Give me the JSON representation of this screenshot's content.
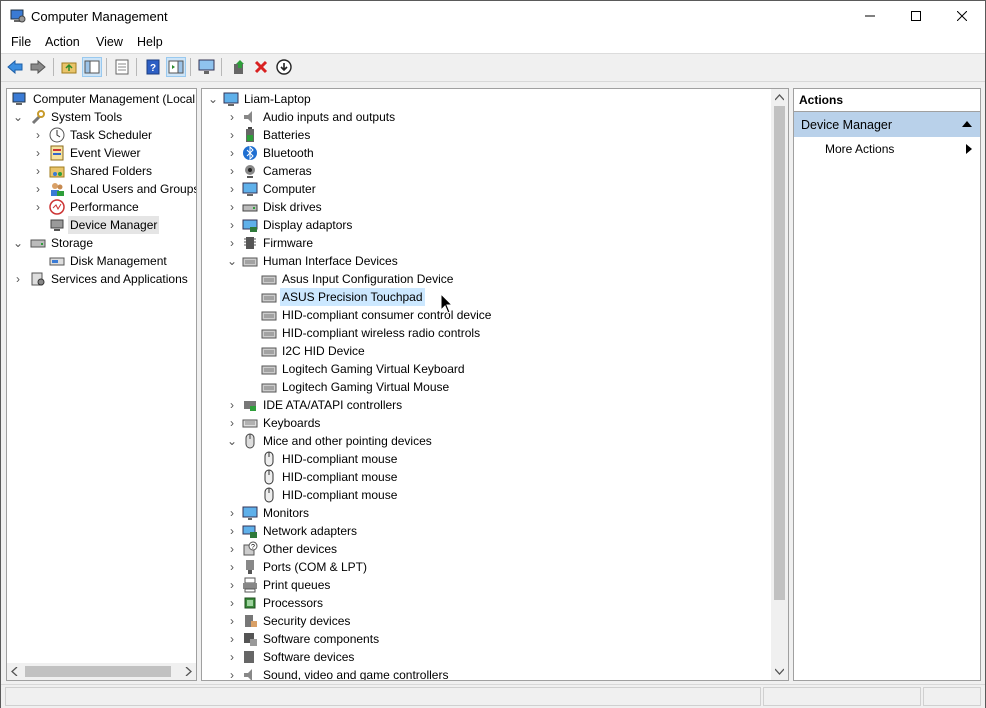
{
  "window": {
    "title": "Computer Management"
  },
  "menu": [
    "File",
    "Action",
    "View",
    "Help"
  ],
  "left_tree": {
    "root": "Computer Management (Local",
    "system_tools": "System Tools",
    "task_scheduler": "Task Scheduler",
    "event_viewer": "Event Viewer",
    "shared_folders": "Shared Folders",
    "local_users": "Local Users and Groups",
    "performance": "Performance",
    "device_manager": "Device Manager",
    "storage": "Storage",
    "disk_management": "Disk Management",
    "services": "Services and Applications"
  },
  "device_tree": {
    "computer": "Liam-Laptop",
    "categories": [
      "Audio inputs and outputs",
      "Batteries",
      "Bluetooth",
      "Cameras",
      "Computer",
      "Disk drives",
      "Display adaptors",
      "Firmware",
      "Human Interface Devices",
      "IDE ATA/ATAPI controllers",
      "Keyboards",
      "Mice and other pointing devices",
      "Monitors",
      "Network adapters",
      "Other devices",
      "Ports (COM & LPT)",
      "Print queues",
      "Processors",
      "Security devices",
      "Software components",
      "Software devices",
      "Sound, video and game controllers"
    ],
    "hid_devices": [
      "Asus Input Configuration Device",
      "ASUS Precision Touchpad",
      "HID-compliant consumer control device",
      "HID-compliant wireless radio controls",
      "I2C HID Device",
      "Logitech Gaming Virtual Keyboard",
      "Logitech Gaming Virtual Mouse"
    ],
    "mice_devices": [
      "HID-compliant mouse",
      "HID-compliant mouse",
      "HID-compliant mouse"
    ]
  },
  "actions": {
    "header": "Actions",
    "section": "Device Manager",
    "more": "More Actions"
  },
  "colors": {
    "selection": "#e5e5e5",
    "hover": "#cce8ff",
    "actions_section": "#b9d1ea"
  }
}
